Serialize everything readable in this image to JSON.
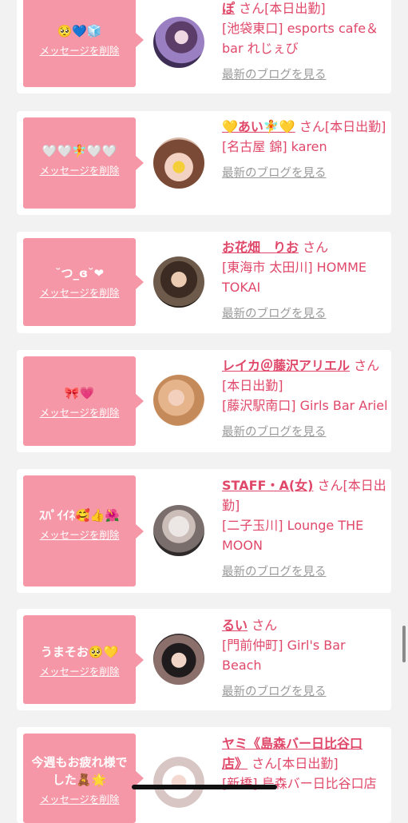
{
  "colors": {
    "accent": "#e0486a",
    "bubble": "#f597a6",
    "blog_link": "#9a9a9a",
    "background": "#f2f2f2"
  },
  "delete_label": "メッセージを削除",
  "blog_label": "最新のブログを見る",
  "cards": [
    {
      "message": "🥺💙🧊",
      "name": "ぽ",
      "san": " さん",
      "shift": "[本日出勤]",
      "shop": "[池袋東口] esports cafe＆bar れじぇび"
    },
    {
      "message": "🤍🤍🧚🤍🤍",
      "name": "💛あい🧚💛",
      "san": " さん",
      "shift": "[本日出勤]",
      "shop": "[名古屋 錦] karen"
    },
    {
      "message": "˘つ_ɞ˘❤︎",
      "name": "お花畑　りお",
      "san": " さん",
      "shift": "",
      "shop": "[東海市 太田川] HOMME TOKAI"
    },
    {
      "message": "🎀💗",
      "name": "レイカ＠藤沢アリエル",
      "san": " さん",
      "shift": "[本日出勤]",
      "shop": "[藤沢駅南口] Girls Bar Ariel"
    },
    {
      "message": "ｽﾊﾟｲｲﾈ🥰👍🌺",
      "name": "STAFF・A(女)",
      "san": " さん",
      "shift": "[本日出勤]",
      "shop": "[二子玉川] Lounge THE MOON"
    },
    {
      "message": "うまそお🥺💛",
      "name": "るい",
      "san": " さん",
      "shift": "",
      "shop": "[門前仲町] Girl's Bar Beach"
    },
    {
      "message": "今週もお疲れ様でした🧸🌟",
      "name": "ヤミ《島森バー日比谷口店》",
      "san": " さん",
      "shift": "[本日出勤]",
      "shop": "[新橋] 島森バー日比谷口店"
    }
  ]
}
